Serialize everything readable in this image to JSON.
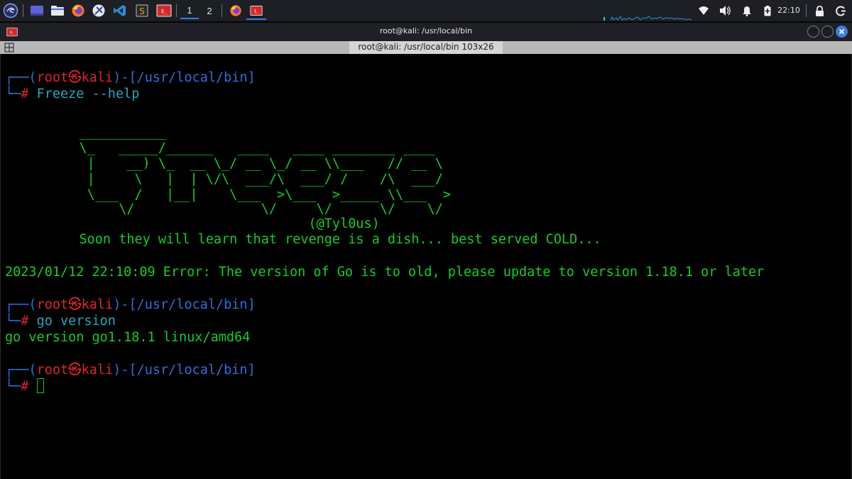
{
  "taskbar": {
    "workspaces": [
      "1",
      "2"
    ],
    "clock": "22:10",
    "app_launchers": [
      "kali-menu-icon",
      "desktop-icon",
      "file-manager-icon",
      "firefox-icon",
      "kali-tools-icon",
      "vscode-icon",
      "sublime-icon",
      "terminal-icon"
    ],
    "running_tasks": [
      "firefox-icon",
      "terminal-icon"
    ]
  },
  "window": {
    "title": "root@kali: /usr/local/bin",
    "tab_title": "root@kali: /usr/local/bin 103x26",
    "controls": [
      "minimize",
      "maximize",
      "close"
    ]
  },
  "terminal": {
    "prompt": {
      "open": "┌──(",
      "user": "root",
      "skull": "㉿",
      "host": "kali",
      "mid": ")-[",
      "path": "/usr/local/bin",
      "close": "]",
      "lead": "└─",
      "hash": "#"
    },
    "cmd1_name": "Freeze",
    "cmd1_args": " --help",
    "banner": [
      "           ___________",
      "           \\_   _____/______   ____   ____ ________ ____",
      "            |    __) \\_  __ \\_/ __ \\_/ __ \\\\___   // __ \\",
      "            |     \\   |  | \\/\\  ___/\\  ___/ /    /\\  ___/",
      "            \\___  /   |__|    \\___  >\\___  >_____ \\\\___  >",
      "                \\/                \\/     \\/      \\/    \\/",
      "                                        (@Tyl0us)",
      "           Soon they will learn that revenge is a dish... best served COLD..."
    ],
    "error_line": "2023/01/12 22:10:09 Error: The version of Go is to old, please update to version 1.18.1 or later",
    "cmd2_name": "go",
    "cmd2_args": " version",
    "cmd2_output": "go version go1.18.1 linux/amd64"
  }
}
